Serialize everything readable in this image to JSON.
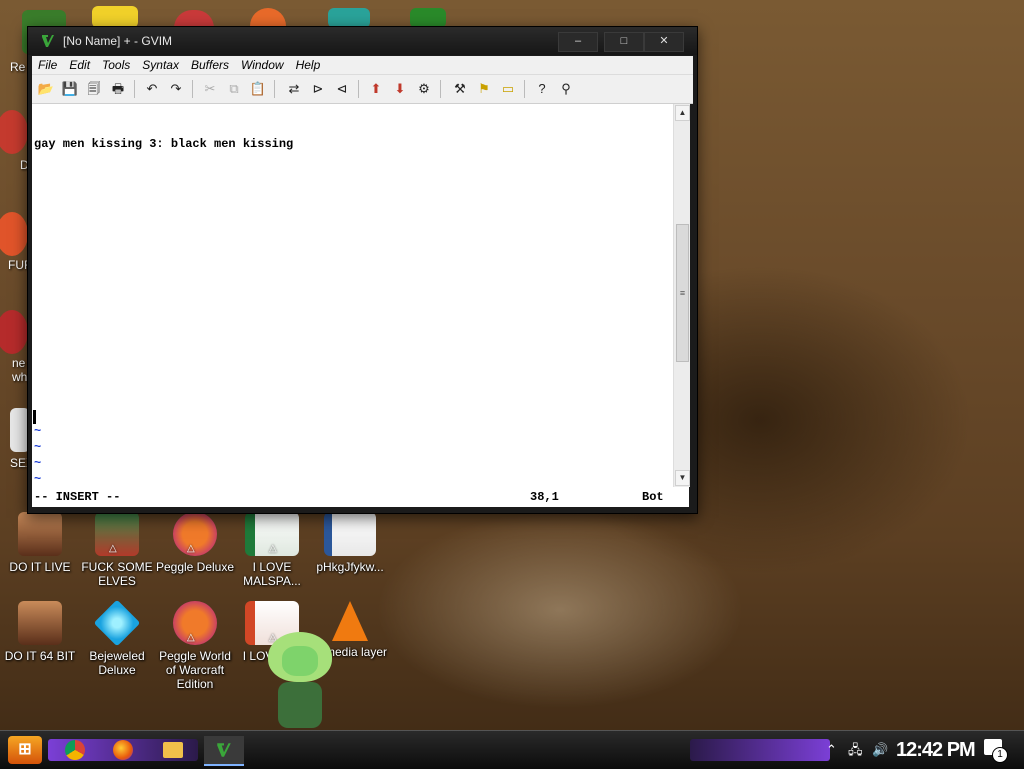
{
  "window": {
    "title": "[No Name] + - GVIM",
    "minimize": "–",
    "maximize": "□",
    "close": "✕"
  },
  "menu": [
    "File",
    "Edit",
    "Tools",
    "Syntax",
    "Buffers",
    "Window",
    "Help"
  ],
  "toolbar_icons": [
    "open-icon",
    "save-icon",
    "save-all-icon",
    "print-icon",
    "undo-icon",
    "redo-icon",
    "cut-icon",
    "copy-icon",
    "paste-icon",
    "replace-icon",
    "find-next-icon",
    "find-prev-icon",
    "load-session-icon",
    "save-session-icon",
    "run-script-icon",
    "make-icon",
    "build-tags-icon",
    "jump-tag-icon",
    "help-icon",
    "find-help-icon"
  ],
  "editor": {
    "text_line": "gay men kissing 3: black men kissing",
    "tilde": "~"
  },
  "status": {
    "mode": "-- INSERT --",
    "position": "38,1",
    "scroll": "Bot"
  },
  "desktop_icons": [
    {
      "label": "DO IT LIVE",
      "icon": "portrait-icon"
    },
    {
      "label": "FUCK SOME ELVES",
      "icon": "game-icon"
    },
    {
      "label": "Peggle Deluxe",
      "icon": "peggle-icon"
    },
    {
      "label": "I LOVE MALSPA...",
      "icon": "excel-icon"
    },
    {
      "label": "pHkgJfykw...",
      "icon": "word-doc-icon"
    },
    {
      "label": "DO IT 64 BIT",
      "icon": "portrait-icon"
    },
    {
      "label": "Bejeweled Deluxe",
      "icon": "gem-icon"
    },
    {
      "label": "Peggle World of Warcraft Edition",
      "icon": "peggle-icon"
    },
    {
      "label": "I LOVE P...",
      "icon": "powerpoint-icon"
    },
    {
      "label": "C media layer",
      "icon": "vlc-icon"
    }
  ],
  "left_partial_labels": [
    "Re",
    "D",
    "FUF",
    "ne",
    "wh",
    "SEX"
  ],
  "taskbar": {
    "clock": "12:42 PM",
    "notification_count": "1"
  },
  "colors": {
    "vim_tilde": "#1a3cd6",
    "taskbar_accent": "#7b3fd6"
  }
}
